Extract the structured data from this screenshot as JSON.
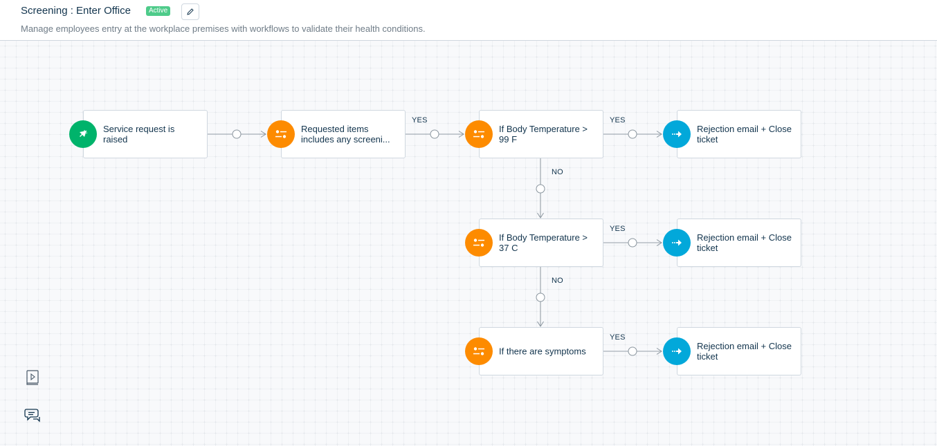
{
  "header": {
    "title": "Screening : Enter Office",
    "status_badge": "Active",
    "edit_icon": "pencil-icon",
    "description": "Manage employees entry at the workplace premises with workflows to validate their health conditions."
  },
  "colors": {
    "trigger": "#00b36b",
    "condition": "#fd8b00",
    "action": "#02a8da",
    "badge": "#4ecb8a"
  },
  "workflow": {
    "nodes": [
      {
        "id": "trigger",
        "type": "trigger",
        "icon": "cursor-click-icon",
        "label": "Service request is raised"
      },
      {
        "id": "cond-items",
        "type": "condition",
        "icon": "sliders-icon",
        "label": "Requested items includes any screeni..."
      },
      {
        "id": "cond-temp-f",
        "type": "condition",
        "icon": "sliders-icon",
        "label": "If Body Temperature > 99 F"
      },
      {
        "id": "action-1",
        "type": "action",
        "icon": "arrow-right-icon",
        "label": "Rejection email + Close ticket"
      },
      {
        "id": "cond-temp-c",
        "type": "condition",
        "icon": "sliders-icon",
        "label": "If Body Temperature > 37 C"
      },
      {
        "id": "action-2",
        "type": "action",
        "icon": "arrow-right-icon",
        "label": "Rejection email + Close ticket"
      },
      {
        "id": "cond-symptoms",
        "type": "condition",
        "icon": "sliders-icon",
        "label": "If there are symptoms"
      },
      {
        "id": "action-3",
        "type": "action",
        "icon": "arrow-right-icon",
        "label": "Rejection email + Close ticket"
      }
    ],
    "edges": [
      {
        "from": "trigger",
        "to": "cond-items",
        "label": ""
      },
      {
        "from": "cond-items",
        "to": "cond-temp-f",
        "label": "YES"
      },
      {
        "from": "cond-temp-f",
        "to": "action-1",
        "label": "YES"
      },
      {
        "from": "cond-temp-f",
        "to": "cond-temp-c",
        "label": "NO"
      },
      {
        "from": "cond-temp-c",
        "to": "action-2",
        "label": "YES"
      },
      {
        "from": "cond-temp-c",
        "to": "cond-symptoms",
        "label": "NO"
      },
      {
        "from": "cond-symptoms",
        "to": "action-3",
        "label": "YES"
      }
    ]
  },
  "sidebar_tools": [
    {
      "name": "video-guide",
      "icon": "play-book-icon"
    },
    {
      "name": "feedback",
      "icon": "chat-bubbles-icon"
    }
  ]
}
